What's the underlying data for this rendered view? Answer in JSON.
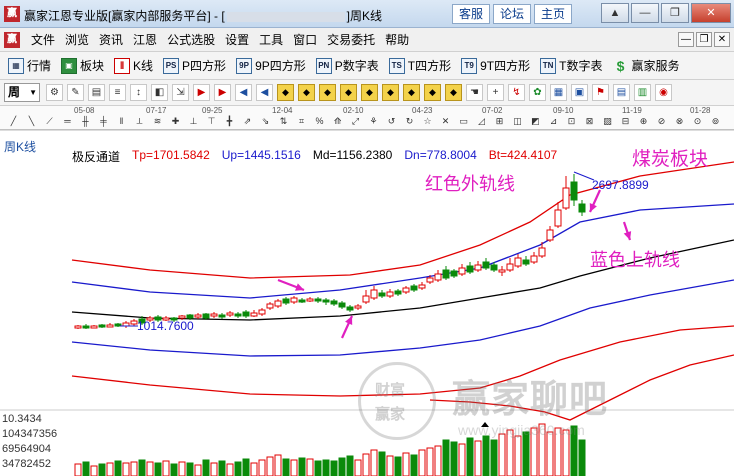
{
  "window": {
    "title_prefix": "赢家江恩专业版[赢家内部服务平台] - [",
    "title_suffix": "]周K线",
    "links": [
      "客服",
      "论坛",
      "主页"
    ],
    "controls": [
      "▲",
      "—",
      "❐",
      "✕"
    ]
  },
  "menu": {
    "items": [
      "文件",
      "浏览",
      "资讯",
      "江恩",
      "公式选股",
      "设置",
      "工具",
      "窗口",
      "交易委托",
      "帮助"
    ],
    "mdi": [
      "—",
      "❐",
      "✕"
    ]
  },
  "toolbar1": {
    "items": [
      {
        "icon": "grid-icon",
        "glyph": "▦",
        "label": "行情"
      },
      {
        "icon": "blocks-icon",
        "glyph": "▣",
        "label": "板块"
      },
      {
        "icon": "kline-icon",
        "glyph": "⫼",
        "label": "K线"
      },
      {
        "icon": "p-square-icon",
        "glyph": "PS",
        "label": "P四方形"
      },
      {
        "icon": "9p-square-icon",
        "glyph": "9P",
        "label": "9P四方形"
      },
      {
        "icon": "p-table-icon",
        "glyph": "PN",
        "label": "P数字表"
      },
      {
        "icon": "t-square-icon",
        "glyph": "TS",
        "label": "T四方形"
      },
      {
        "icon": "9t-square-icon",
        "glyph": "T9",
        "label": "9T四方形"
      },
      {
        "icon": "t-table-icon",
        "glyph": "TN",
        "label": "T数字表"
      },
      {
        "icon": "dollar-icon",
        "glyph": "$",
        "label": "赢家服务"
      }
    ]
  },
  "toolbar2": {
    "period": "周",
    "icons": [
      "⚙",
      "✎",
      "▤",
      "≡",
      "↕",
      "◧",
      "⇲",
      "▶",
      "▶",
      "◀",
      "◀",
      "◆",
      "◆",
      "◆",
      "◆",
      "◆",
      "◆",
      "◆",
      "◆",
      "◆",
      "☚",
      "+",
      "↯",
      "✿",
      "▦",
      "▣",
      "⚑",
      "▤",
      "▥",
      "◉"
    ]
  },
  "timeline": {
    "dates": [
      "05-08",
      "07-17",
      "09-25",
      "12-04",
      "02-10",
      "04-23",
      "07-02",
      "09-10",
      "11-19",
      "01-28"
    ]
  },
  "chart": {
    "period_label": "周K线",
    "indicator_name": "极反通道",
    "values": [
      {
        "label": "Tp=1701.5842",
        "color": "#e00000"
      },
      {
        "label": "Up=1445.1516",
        "color": "#1a1acc"
      },
      {
        "label": "Md=1156.2380",
        "color": "#000000"
      },
      {
        "label": "Dn=778.8004",
        "color": "#1a1acc"
      },
      {
        "label": "Bt=424.4107",
        "color": "#e00000"
      }
    ],
    "high_label": "2697.8899",
    "low_label": "1014.7600",
    "volume_labels": [
      "10.3434",
      "104347356",
      "69564904",
      "34782452"
    ],
    "colors": {
      "red": "#e00000",
      "blue": "#1a1acc",
      "black": "#000000",
      "up": "#e00000",
      "down": "#0a8a0a",
      "annot": "#e020c0"
    }
  },
  "annotations": {
    "sector": "煤炭板块",
    "red_line": "红色外轨线",
    "blue_line": "蓝色上轨线"
  },
  "watermark": {
    "text": "赢家聊吧",
    "badge_top": "财富",
    "badge_bottom": "赢家",
    "url": "www.yingjia360.com"
  }
}
